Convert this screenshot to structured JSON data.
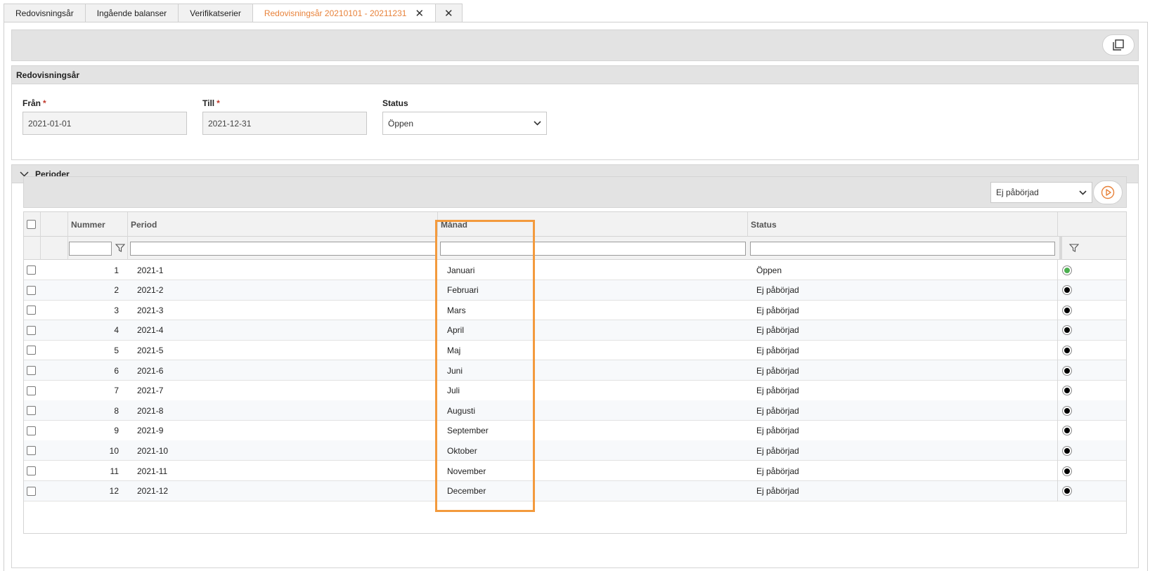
{
  "tabs": [
    {
      "label": "Redovisningsår"
    },
    {
      "label": "Ingående balanser"
    },
    {
      "label": "Verifikatserier"
    },
    {
      "label": "Redovisningsår 20210101 - 20211231"
    }
  ],
  "accounting_year": {
    "header": "Redovisningsår",
    "from": {
      "label": "Från",
      "required_mark": "*",
      "value": "2021-01-01"
    },
    "to": {
      "label": "Till",
      "required_mark": "*",
      "value": "2021-12-31"
    },
    "status": {
      "label": "Status",
      "value": "Öppen"
    }
  },
  "periods": {
    "header": "Perioder",
    "status_select_value": "Ej påbörjad",
    "columns": {
      "number": "Nummer",
      "period": "Period",
      "month": "Månad",
      "status": "Status"
    },
    "rows": [
      {
        "number": "1",
        "period": "2021-1",
        "month": "Januari",
        "status": "Öppen",
        "indicator": "green"
      },
      {
        "number": "2",
        "period": "2021-2",
        "month": "Februari",
        "status": "Ej påbörjad",
        "indicator": "black"
      },
      {
        "number": "3",
        "period": "2021-3",
        "month": "Mars",
        "status": "Ej påbörjad",
        "indicator": "black"
      },
      {
        "number": "4",
        "period": "2021-4",
        "month": "April",
        "status": "Ej påbörjad",
        "indicator": "black"
      },
      {
        "number": "5",
        "period": "2021-5",
        "month": "Maj",
        "status": "Ej påbörjad",
        "indicator": "black"
      },
      {
        "number": "6",
        "period": "2021-6",
        "month": "Juni",
        "status": "Ej påbörjad",
        "indicator": "black"
      },
      {
        "number": "7",
        "period": "2021-7",
        "month": "Juli",
        "status": "Ej påbörjad",
        "indicator": "black"
      },
      {
        "number": "8",
        "period": "2021-8",
        "month": "Augusti",
        "status": "Ej påbörjad",
        "indicator": "black"
      },
      {
        "number": "9",
        "period": "2021-9",
        "month": "September",
        "status": "Ej påbörjad",
        "indicator": "black"
      },
      {
        "number": "10",
        "period": "2021-10",
        "month": "Oktober",
        "status": "Ej påbörjad",
        "indicator": "black"
      },
      {
        "number": "11",
        "period": "2021-11",
        "month": "November",
        "status": "Ej påbörjad",
        "indicator": "black"
      },
      {
        "number": "12",
        "period": "2021-12",
        "month": "December",
        "status": "Ej påbörjad",
        "indicator": "black"
      }
    ]
  },
  "colors": {
    "accent": "#e8823a",
    "highlight": "#f39a3d",
    "indicator_green": "#4caf50",
    "indicator_black": "#000000"
  },
  "icons": {
    "tab_close": "close-icon",
    "copy": "copy-icon",
    "collapse": "chevron-down-icon",
    "filter": "funnel-icon",
    "run": "play-circle-icon"
  }
}
